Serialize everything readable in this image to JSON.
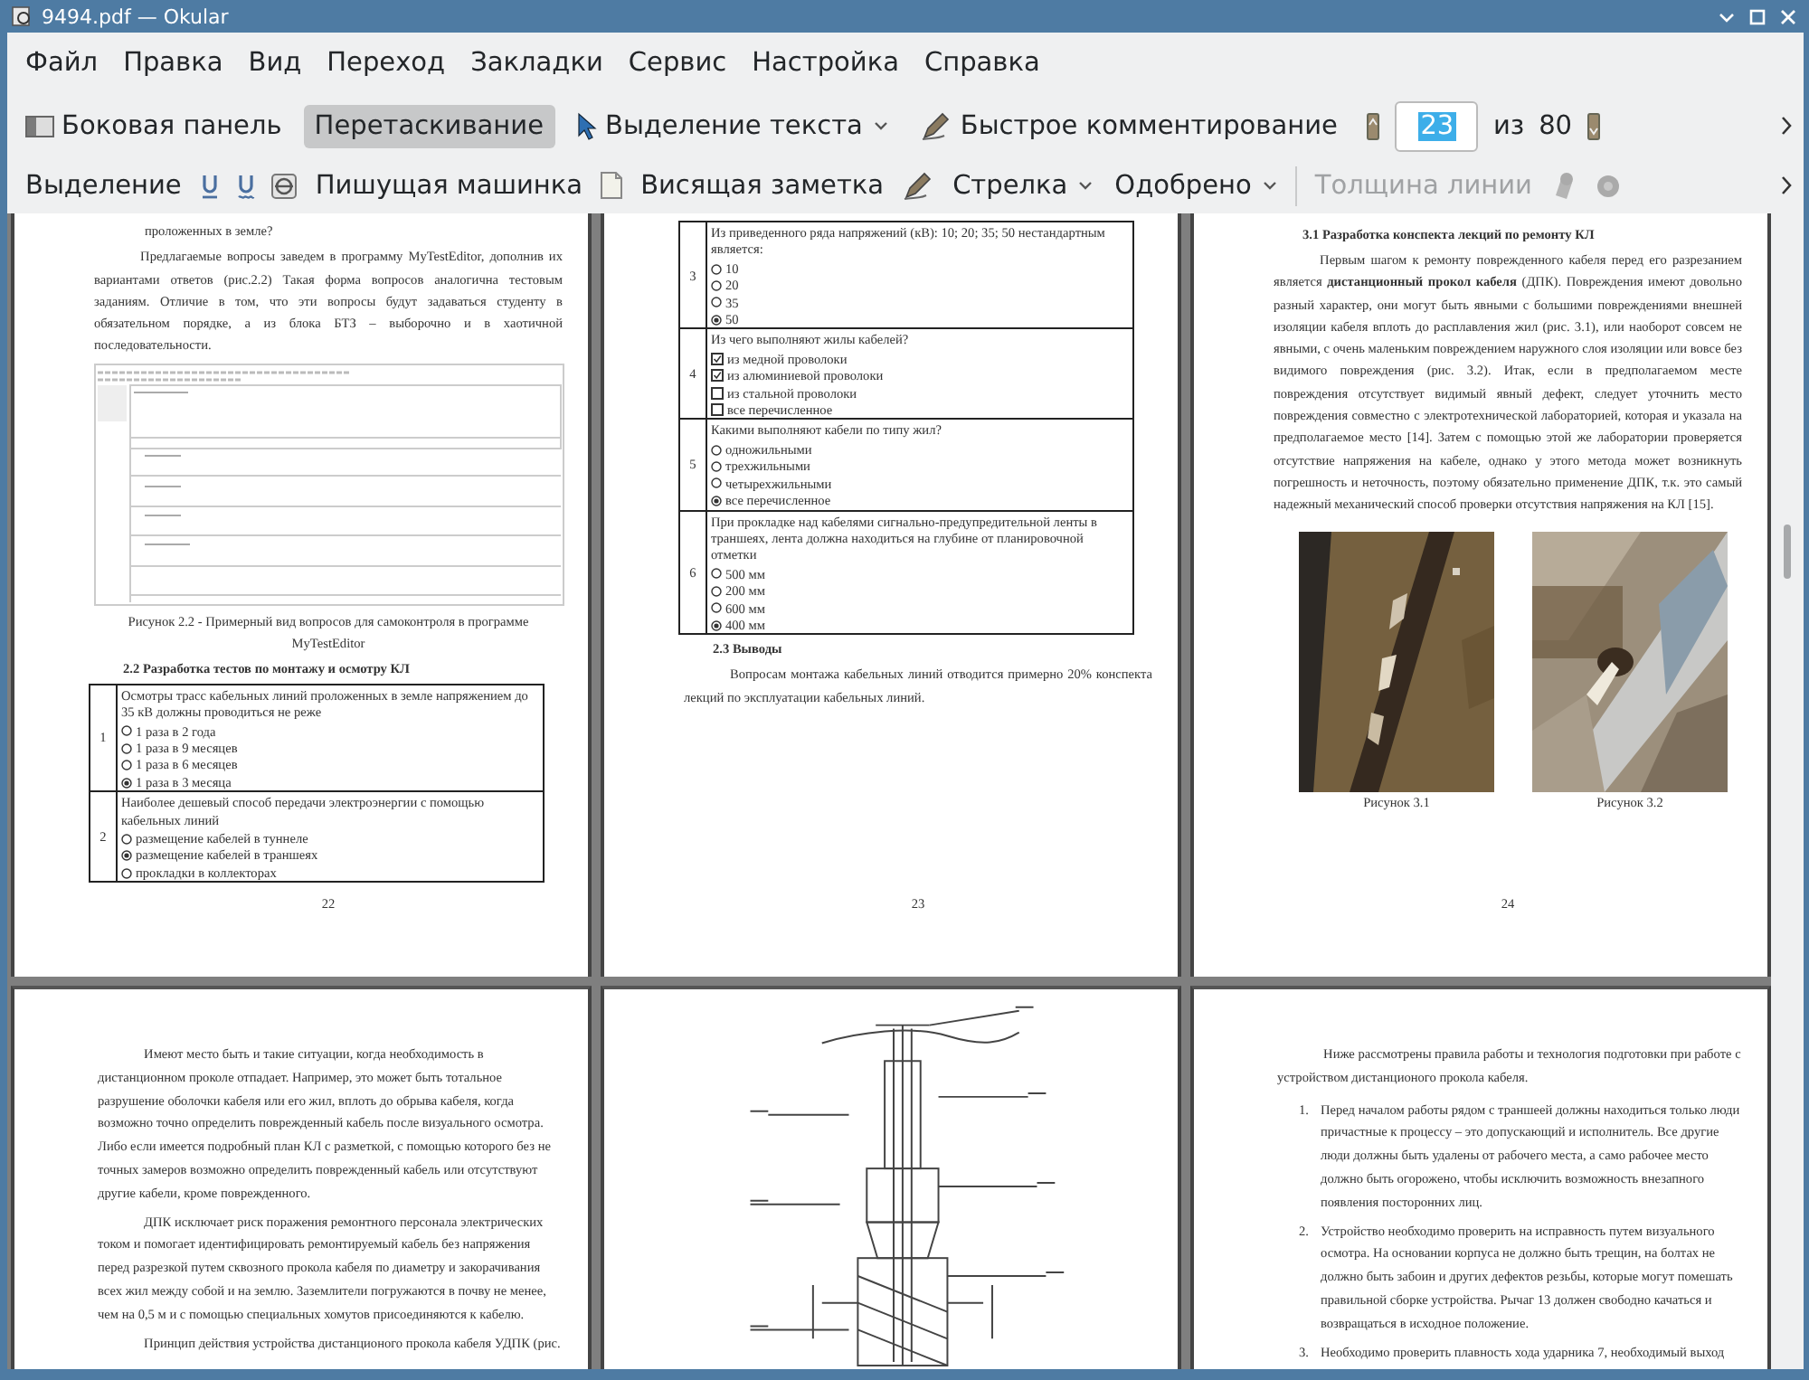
{
  "window": {
    "title": "9494.pdf — Okular"
  },
  "menu": [
    "Файл",
    "Правка",
    "Вид",
    "Переход",
    "Закладки",
    "Сервис",
    "Настройка",
    "Справка"
  ],
  "toolbar": [
    {
      "kind": "icon_button",
      "label": "Боковая панель",
      "selected": false
    },
    {
      "kind": "text_button",
      "label": "Перетаскивание",
      "selected": true
    },
    {
      "kind": "icon_dropdown",
      "label": "Выделение текста",
      "selected": false
    },
    {
      "kind": "icon_button",
      "label": "Быстрое комментирование",
      "selected": false
    }
  ],
  "page_nav": {
    "value": "23",
    "value_selected": true,
    "of": "из",
    "total": "80"
  },
  "annotation_toolbar": [
    {
      "kind": "text",
      "label": "Выделение",
      "disabled": false
    },
    {
      "kind": "text",
      "label": "Пишущая машинка",
      "disabled": false
    },
    {
      "kind": "text",
      "label": "Висящая заметка",
      "disabled": false
    },
    {
      "kind": "dropdown",
      "label": "Стрелка",
      "disabled": false
    },
    {
      "kind": "dropdown",
      "label": "Одобрено",
      "disabled": false
    },
    {
      "kind": "text",
      "label": "Толщина линии",
      "disabled": true
    }
  ],
  "pages": [
    {
      "blocks": [
        {
          "kind": "continuation",
          "text": "проложенных в земле?"
        },
        {
          "kind": "paragraph",
          "text": "Предлагаемые вопросы заведем в программу MyTestEditor, дополнив их вариантами ответов (рис.2.2) Такая форма вопросов аналогична тестовым заданиям. Отличие в том, что эти вопросы будут задаваться студенту в обязательном порядке, а из блока БТЗ – выборочно и в хаотичной последовательности."
        },
        {
          "kind": "screenshot"
        },
        {
          "kind": "caption",
          "text": "Рисунок 2.2 - Примерный вид вопросов для самоконтроля в программе MyTestEditor"
        },
        {
          "kind": "heading",
          "text": "2.2 Разработка тестов по монтажу и осмотру КЛ"
        },
        {
          "kind": "quiz",
          "rows": [
            {
              "number": "1",
              "question": "Осмотры трасс кабельных линий проложенных в земле напряжением до 35 кВ должны проводиться не реже",
              "options": [
                {
                  "kind": "radio",
                  "text": "1 раза в 2 года",
                  "checked": false
                },
                {
                  "kind": "radio",
                  "text": "1 раза в 9 месяцев",
                  "checked": false
                },
                {
                  "kind": "radio",
                  "text": "1 раза в 6 месяцев",
                  "checked": false
                },
                {
                  "kind": "radio",
                  "text": "1 раза в 3 месяца",
                  "checked": true
                }
              ]
            },
            {
              "number": "2",
              "question": "Наиболее дешевый способ передачи электроэнергии с помощью кабельных линий",
              "options": [
                {
                  "kind": "radio",
                  "text": "размещение кабелей в туннеле",
                  "checked": false
                },
                {
                  "kind": "radio",
                  "text": "размещение кабелей в траншеях",
                  "checked": true
                },
                {
                  "kind": "radio",
                  "text": "прокладки в коллекторах",
                  "checked": false
                }
              ]
            }
          ]
        },
        {
          "kind": "page_number",
          "text": "22"
        }
      ]
    },
    {
      "blocks": [
        {
          "kind": "quiz",
          "rows": [
            {
              "number": "3",
              "question": "Из приведенного ряда напряжений (кВ): 10; 20; 35; 50 нестандартным является:",
              "options": [
                {
                  "kind": "radio",
                  "text": "10",
                  "checked": false
                },
                {
                  "kind": "radio",
                  "text": "20",
                  "checked": false
                },
                {
                  "kind": "radio",
                  "text": "35",
                  "checked": false
                },
                {
                  "kind": "radio",
                  "text": "50",
                  "checked": true
                }
              ]
            },
            {
              "number": "4",
              "question": "Из чего выполняют жилы кабелей?",
              "options": [
                {
                  "kind": "checkbox",
                  "text": "из медной проволоки",
                  "checked": true
                },
                {
                  "kind": "checkbox",
                  "text": "из алюминиевой проволоки",
                  "checked": true
                },
                {
                  "kind": "checkbox",
                  "text": "из стальной проволоки",
                  "checked": false
                },
                {
                  "kind": "checkbox",
                  "text": "все перечисленное",
                  "checked": false
                }
              ]
            },
            {
              "number": "5",
              "question": "Какими выполняют кабели по типу жил?",
              "options": [
                {
                  "kind": "radio",
                  "text": "одножильными",
                  "checked": false
                },
                {
                  "kind": "radio",
                  "text": "трехжильными",
                  "checked": false
                },
                {
                  "kind": "radio",
                  "text": "четырехжильными",
                  "checked": false
                },
                {
                  "kind": "radio",
                  "text": "все перечисленное",
                  "checked": true
                }
              ]
            },
            {
              "number": "6",
              "question": "При прокладке над кабелями сигнально-предупредительной ленты в траншеях, лента должна находиться на глубине от планировочной отметки",
              "options": [
                {
                  "kind": "radio",
                  "text": "500 мм",
                  "checked": false
                },
                {
                  "kind": "radio",
                  "text": "200 мм",
                  "checked": false
                },
                {
                  "kind": "radio",
                  "text": "600 мм",
                  "checked": false
                },
                {
                  "kind": "radio",
                  "text": "400 мм",
                  "checked": true
                }
              ]
            }
          ]
        },
        {
          "kind": "heading",
          "text": "2.3 Выводы"
        },
        {
          "kind": "paragraph",
          "text": "Вопросам монтажа кабельных линий отводится примерно 20% конспекта лекций по эксплуатации кабельных линий."
        },
        {
          "kind": "page_number",
          "text": "23"
        }
      ]
    },
    {
      "blocks": [
        {
          "kind": "heading",
          "text": "3.1 Разработка конспекта лекций по ремонту КЛ"
        },
        {
          "kind": "paragraph",
          "text": "Первым шагом к ремонту поврежденного кабеля перед его разрезанием является **дистанционный прокол кабеля** (ДПК). Повреждения имеют довольно разный характер, они могут быть явными с большими повреждениями внешней изоляции кабеля вплоть до расплавления жил (рис. 3.1), или наоборот совсем не явными, с очень маленьким повреждением наружного слоя изоляции или вовсе без видимого повреждения (рис. 3.2). Итак, если в предполагаемом месте повреждения отсутствует видимый явный дефект, следует уточнить место повреждения совместно с электротехнической лабораторией, которая и указала на предполагаемое место [14]. Затем с помощью этой же лаборатории проверяется отсутствие напряжения на кабеле, однако у этого метода может возникнуть погрешность и неточность, поэтому обязательно применение ДПК, т.к. это самый надежный механический способ проверки отсутствия напряжения на КЛ [15]."
        },
        {
          "kind": "photos",
          "items": [
            {
              "caption": "Рисунок 3.1"
            },
            {
              "caption": "Рисунок 3.2"
            }
          ]
        },
        {
          "kind": "page_number",
          "text": "24"
        }
      ]
    },
    {
      "blocks": [
        {
          "kind": "paragraph_left",
          "text": "Имеют место быть и такие ситуации, когда необходимость в дистанционном проколе отпадает. Например, это может быть тотальное разрушение оболочки кабеля или его жил, вплоть до обрыва кабеля, когда возможно точно определить поврежденный кабель после визуального осмотра. Либо если имеется подробный план КЛ с разметкой, с помощью которого без не точных замеров возможно определить поврежденный кабель или отсутствуют другие кабели, кроме поврежденного."
        },
        {
          "kind": "paragraph_left",
          "text": "ДПК исключает риск поражения ремонтного персонала электрических током и помогает идентифицировать ремонтируемый кабель без напряжения перед разрезкой путем сквозного прокола кабеля по диаметру и закорачивания всех жил между собой и на землю. Заземлители погружаются в почву не менее, чем на 0,5 м и с помощью специальных хомутов присоединяются к кабелю."
        },
        {
          "kind": "paragraph_left",
          "text": "Принцип действия устройства дистанционого прокола кабеля УДПК (рис."
        }
      ]
    },
    {
      "blocks": [
        {
          "kind": "drawing"
        }
      ]
    },
    {
      "blocks": [
        {
          "kind": "paragraph_left",
          "text": "Ниже рассмотрены правила работы и технология подготовки при работе с устройством дистанционого прокола кабеля."
        },
        {
          "kind": "list",
          "items": [
            {
              "number": "1.",
              "text": "Перед началом работы рядом с траншеей должны находиться только люди причастные к процессу – это допускающий и исполнитель. Все другие люди должны быть удалены от рабочего места, а само рабочее место должно быть огорожено, чтобы исключить возможность внезапного появления посторонних лиц."
            },
            {
              "number": "2.",
              "text": "Устройство необходимо проверить на исправность путем визуального осмотра. На основании корпуса не должно быть трещин, на болтах не должно быть забоин и других дефектов резьбы, которые могут помешать правильной сборке устройства. Рычаг 13 должен свободно качаться и возвращаться в исходное положение."
            },
            {
              "number": "3.",
              "text": "Необходимо проверить плавность хода ударника 7, необходимый выход"
            }
          ]
        }
      ]
    }
  ]
}
